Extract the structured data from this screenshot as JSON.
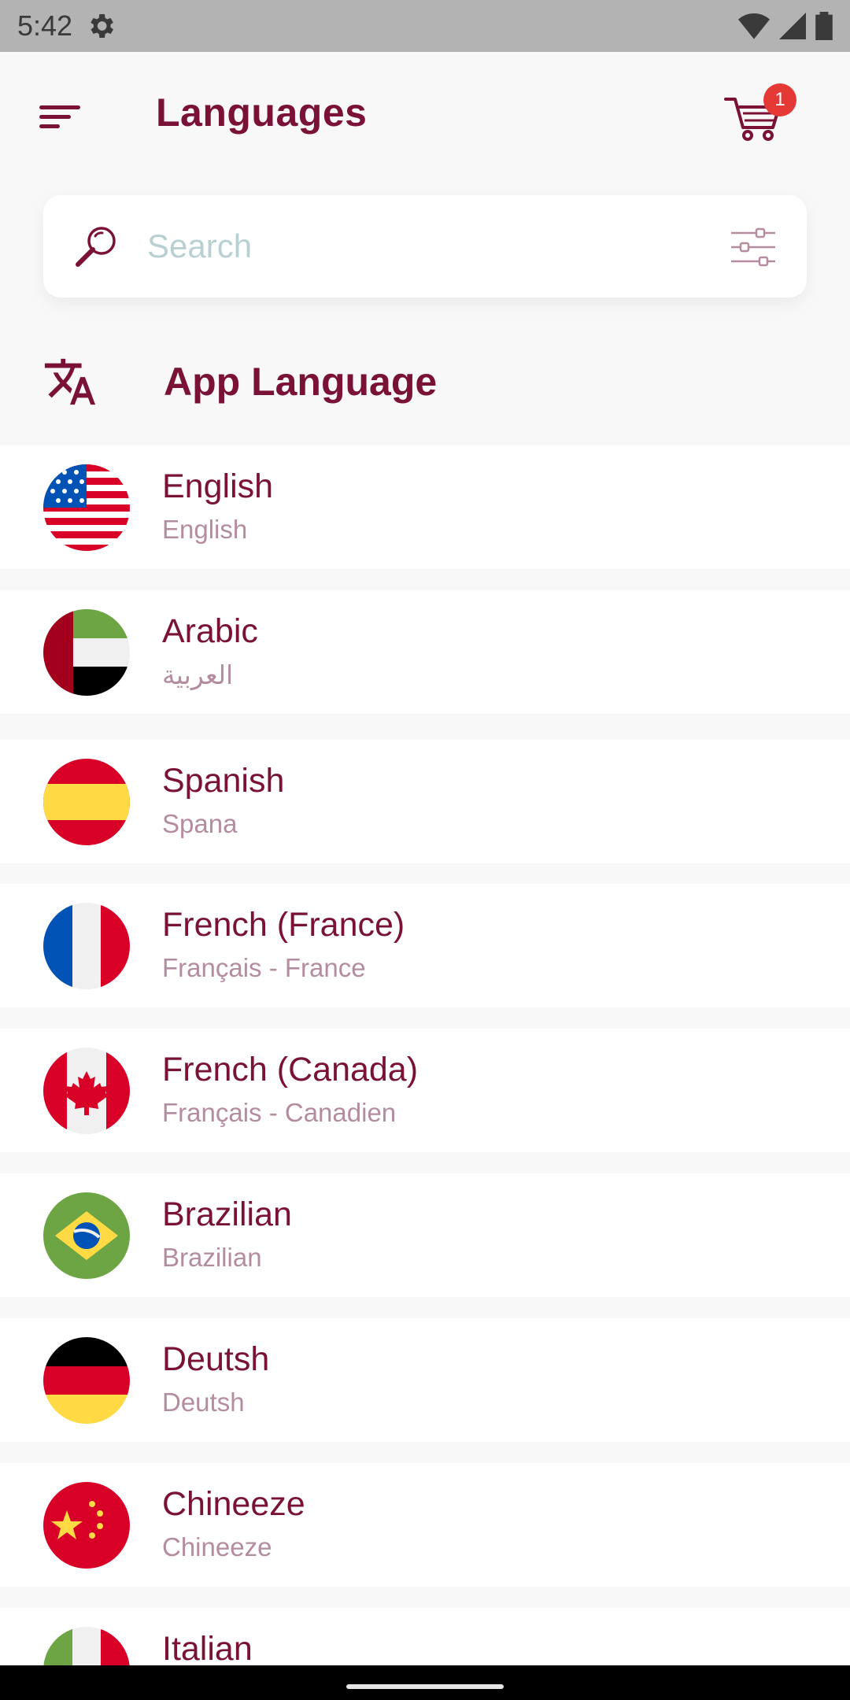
{
  "status_bar": {
    "time": "5:42"
  },
  "header": {
    "title": "Languages",
    "cart_count": "1"
  },
  "search": {
    "placeholder": "Search"
  },
  "section": {
    "title": "App Language"
  },
  "colors": {
    "primary": "#7a1238",
    "secondary_text": "#b48ca0",
    "badge": "#e53935",
    "placeholder": "#b9d0d2"
  },
  "languages": [
    {
      "name": "English",
      "native": "English",
      "flag": "usa-flag-icon"
    },
    {
      "name": "Arabic",
      "native": "العربية",
      "flag": "uae-flag-icon"
    },
    {
      "name": "Spanish",
      "native": "Spana",
      "flag": "spain-flag-icon"
    },
    {
      "name": "French (France)",
      "native": "Français - France",
      "flag": "france-flag-icon"
    },
    {
      "name": "French (Canada)",
      "native": "Français - Canadien",
      "flag": "canada-flag-icon"
    },
    {
      "name": "Brazilian",
      "native": "Brazilian",
      "flag": "brazil-flag-icon"
    },
    {
      "name": "Deutsh",
      "native": "Deutsh",
      "flag": "germany-flag-icon"
    },
    {
      "name": "Chineeze",
      "native": "Chineeze",
      "flag": "china-flag-icon"
    },
    {
      "name": "Italian",
      "native": "",
      "flag": "italy-flag-icon"
    }
  ]
}
